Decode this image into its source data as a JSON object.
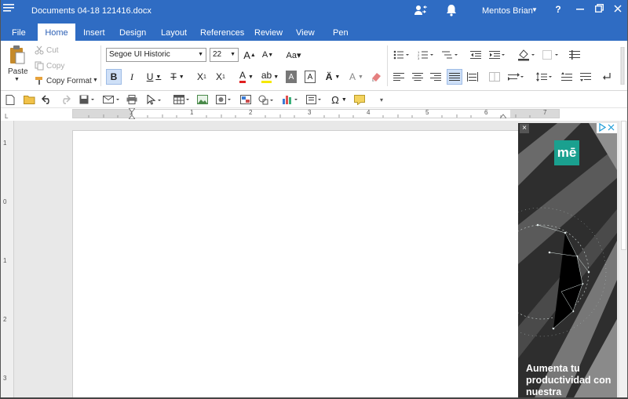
{
  "titlebar": {
    "document_title": "Documents 04-18 121416.docx",
    "user_name": "Mentos Brian",
    "help_label": "?"
  },
  "tabs": [
    {
      "label": "File"
    },
    {
      "label": "Home",
      "active": true
    },
    {
      "label": "Insert"
    },
    {
      "label": "Design"
    },
    {
      "label": "Layout"
    },
    {
      "label": "References"
    },
    {
      "label": "Review"
    },
    {
      "label": "View"
    },
    {
      "label": "Pen"
    }
  ],
  "clipboard": {
    "paste_label": "Paste",
    "cut_label": "Cut",
    "copy_label": "Copy",
    "copy_format_label": "Copy Format"
  },
  "font": {
    "family": "Segoe UI Historic",
    "size": "22"
  },
  "ruler": {
    "h_ticks": [
      "1",
      "1",
      "2",
      "3",
      "4",
      "5",
      "6",
      "7"
    ],
    "v_ticks": [
      "1",
      "0",
      "1",
      "2",
      "3"
    ],
    "corner": "L"
  },
  "ad": {
    "logo_text": "mē",
    "headline": "Aumenta tu productividad con nuestra",
    "close_label": "×"
  },
  "colors": {
    "titlebar_bg": "#2f6cc3",
    "active_tab_text": "#2b5fb5",
    "bold_active_bg": "#cfe0f7",
    "font_color_underline": "#e02020",
    "highlight_color": "#f5e800",
    "ad_accent": "#1aa08f"
  }
}
